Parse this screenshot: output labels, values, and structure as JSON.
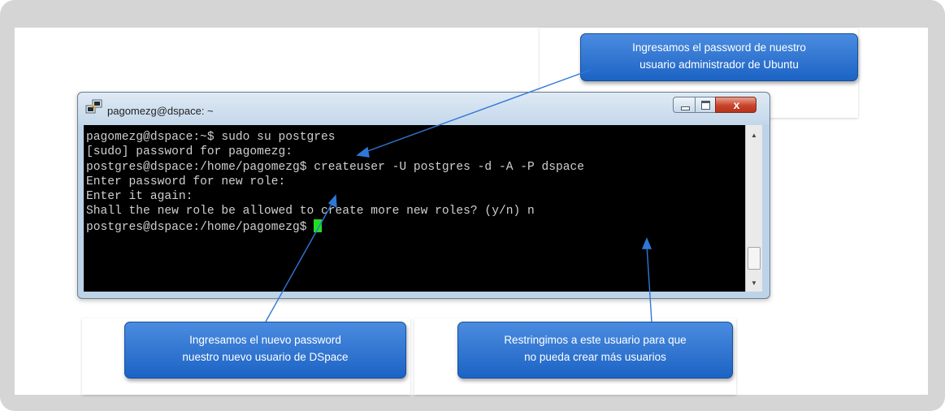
{
  "terminal": {
    "title": "pagomezg@dspace: ~",
    "close_label": "x",
    "lines": [
      "pagomezg@dspace:~$ sudo su postgres",
      "[sudo] password for pagomezg:",
      "postgres@dspace:/home/pagomezg$ createuser -U postgres -d -A -P dspace",
      "Enter password for new role:",
      "Enter it again:",
      "Shall the new role be allowed to create more new roles? (y/n) n",
      "postgres@dspace:/home/pagomezg$ "
    ]
  },
  "callouts": {
    "top": [
      "Ingresamos el password de nuestro",
      "usuario administrador de Ubuntu"
    ],
    "bottom_left": [
      "Ingresamos el nuevo password",
      "nuestro nuevo usuario de DSpace"
    ],
    "bottom_right": [
      "Restringimos a este usuario para que",
      "no pueda crear más usuarios"
    ]
  },
  "colors": {
    "callout": "#2f77d6",
    "cursor": "#22dd22",
    "console_bg": "#000000",
    "frame": "#d5d5d5"
  }
}
